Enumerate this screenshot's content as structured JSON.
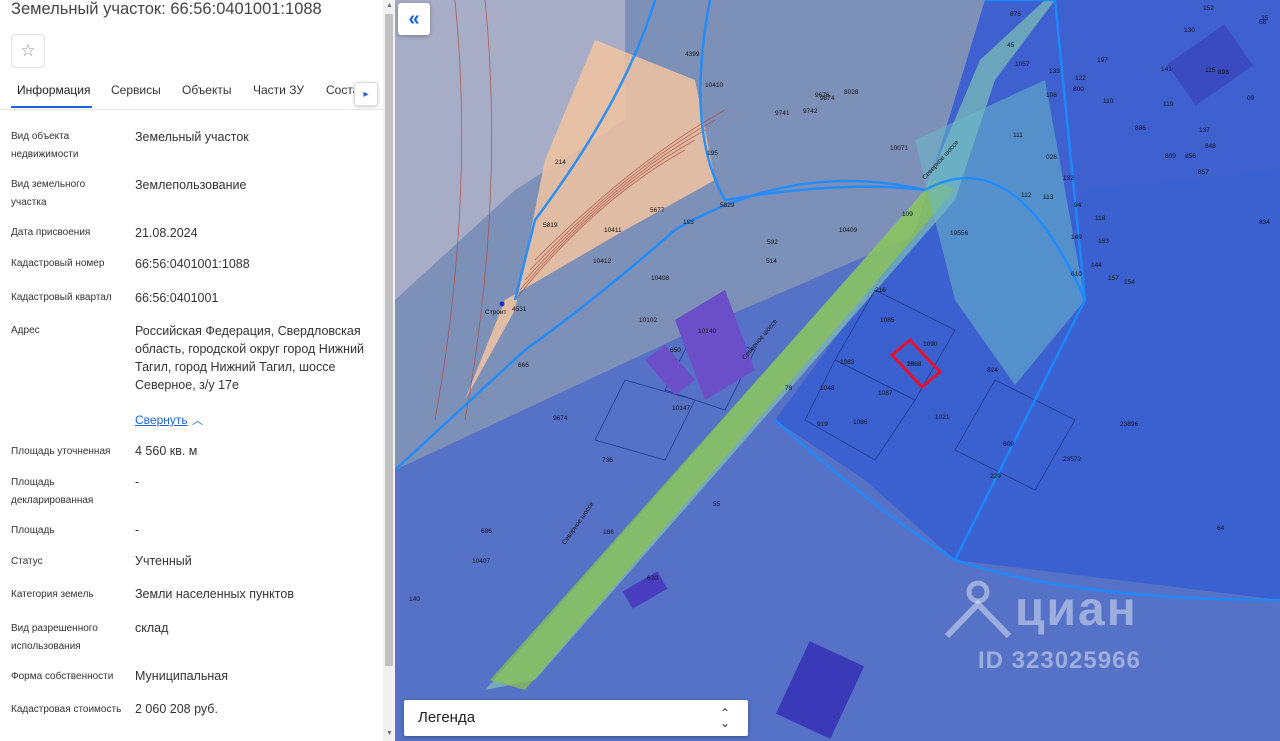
{
  "panel": {
    "title": "Земельный участок: 66:56:0401001:1088",
    "favorite_icon": "star-icon",
    "tabs": [
      {
        "label": "Информация",
        "active": true
      },
      {
        "label": "Сервисы",
        "active": false
      },
      {
        "label": "Объекты",
        "active": false
      },
      {
        "label": "Части ЗУ",
        "active": false
      },
      {
        "label": "Соста",
        "active": false
      }
    ],
    "tabs_scroll_icon": "chevron-right-icon",
    "properties": [
      {
        "label": "Вид объекта недвижимости",
        "value": "Земельный участок"
      },
      {
        "label": "Вид земельного участка",
        "value": "Землепользование"
      },
      {
        "label": "Дата присвоения",
        "value": "21.08.2024"
      },
      {
        "label": "Кадастровый номер",
        "value": "66:56:0401001:1088"
      },
      {
        "label": "Кадастровый квартал",
        "value": "66:56:0401001"
      },
      {
        "label": "Адрес",
        "value": "Российская Федерация, Свердловская область, городской округ город Нижний Тагил, город Нижний Тагил, шоссе Северное, з/у 17е"
      },
      {
        "label": "Площадь уточненная",
        "value": "4 560 кв. м"
      },
      {
        "label": "Площадь декларированная",
        "value": "-"
      },
      {
        "label": "Площадь",
        "value": "-"
      },
      {
        "label": "Статус",
        "value": "Учтенный"
      },
      {
        "label": "Категория земель",
        "value": "Земли населенных пунктов"
      },
      {
        "label": "Вид разрешенного использования",
        "value": "склад"
      },
      {
        "label": "Форма собственности",
        "value": "Муниципальная"
      },
      {
        "label": "Кадастровая стоимость",
        "value": "2 060 208 руб."
      }
    ],
    "collapse_link": "Свернуть"
  },
  "map": {
    "back_icon": "double-chevron-left-icon",
    "legend_label": "Легенда",
    "legend_icon": "chevron-up-down-icon",
    "watermark": {
      "name": "циан",
      "id": "ID 323025966"
    },
    "selected_parcel": "1088",
    "parcel_labels": [
      "1088",
      "1090",
      "1085",
      "1083",
      "1087",
      "1086",
      "1021",
      "216",
      "78",
      "1048",
      "919",
      "824",
      "609",
      "229",
      "23896",
      "23572",
      "64",
      "55",
      "620",
      "166",
      "686",
      "10407",
      "140",
      "9674",
      "736",
      "666",
      "10147",
      "10102",
      "10140",
      "650",
      "10408",
      "10412",
      "10411",
      "5819",
      "214",
      "4531",
      "5677",
      "193",
      "5829",
      "592",
      "514",
      "10409",
      "109",
      "19556",
      "10071",
      "9676",
      "9741",
      "9742",
      "9874",
      "8028",
      "10410",
      "4399",
      "195",
      "1057",
      "45",
      "876",
      "133",
      "122",
      "800",
      "197",
      "108",
      "110",
      "119",
      "141",
      "115",
      "898",
      "886",
      "130",
      "152",
      "137",
      "809",
      "856",
      "848",
      "857",
      "111",
      "028",
      "132",
      "112",
      "113",
      "94",
      "118",
      "149",
      "163",
      "144",
      "610",
      "157",
      "154",
      "58",
      "35",
      "09",
      "834",
      "28"
    ],
    "road_labels": [
      "Северное шоссе",
      "Северное шоссе",
      "Северное шоссе"
    ],
    "place_labels": [
      "Строит"
    ],
    "colors": {
      "background": "#7b8fba",
      "zone_blue": "#2a5bd7",
      "road_green": "#8bc34a",
      "parcel_selected": "#e8112d",
      "rail_zone": "#f2c4a0",
      "accent": "#1b63d6"
    }
  }
}
